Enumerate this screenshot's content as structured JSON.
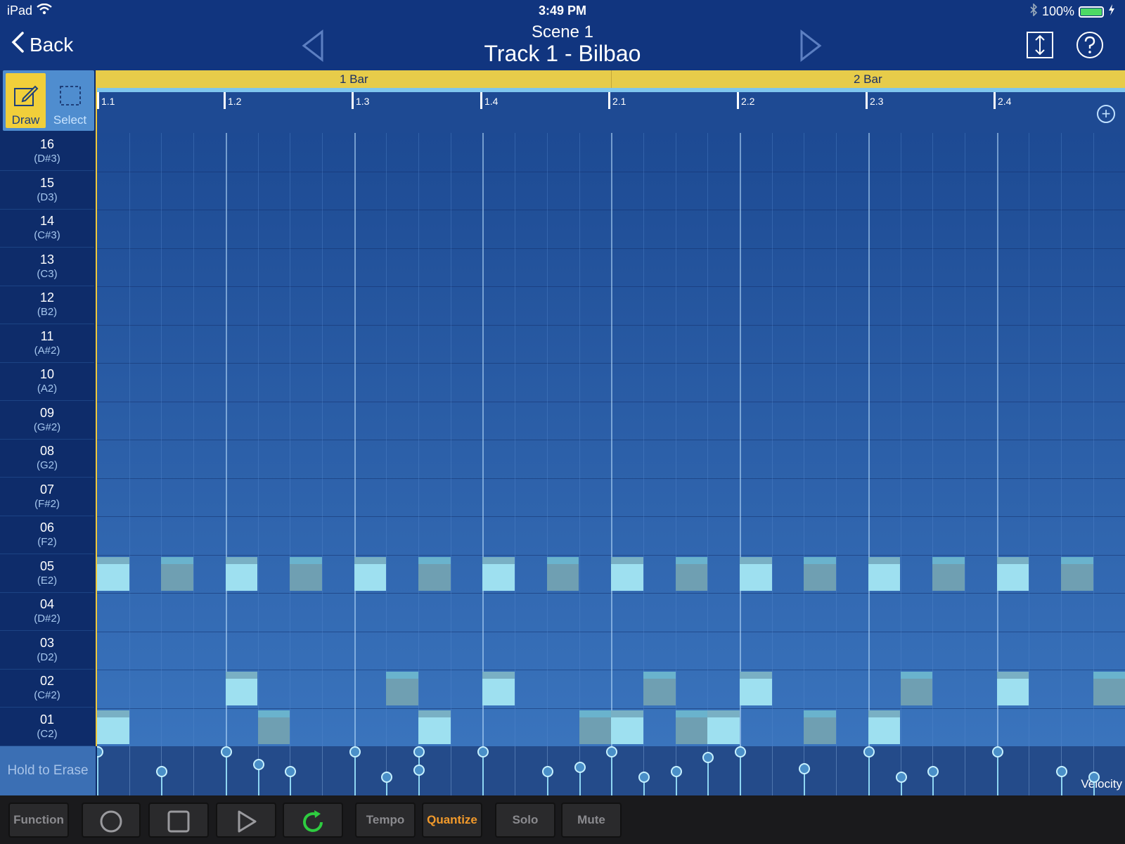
{
  "status": {
    "device": "iPad",
    "time": "3:49 PM",
    "battery": "100%"
  },
  "header": {
    "back_label": "Back",
    "scene": "Scene  1",
    "track": "Track 1 - Bilbao"
  },
  "tools": {
    "draw_label": "Draw",
    "select_label": "Select"
  },
  "ruler": {
    "bars": [
      "1 Bar",
      "2 Bar"
    ],
    "beats": [
      "1.1",
      "1.2",
      "1.3",
      "1.4",
      "2.1",
      "2.2",
      "2.3",
      "2.4"
    ]
  },
  "pads": [
    {
      "num": "16",
      "pitch": "(D#3)"
    },
    {
      "num": "15",
      "pitch": "(D3)"
    },
    {
      "num": "14",
      "pitch": "(C#3)"
    },
    {
      "num": "13",
      "pitch": "(C3)"
    },
    {
      "num": "12",
      "pitch": "(B2)"
    },
    {
      "num": "11",
      "pitch": "(A#2)"
    },
    {
      "num": "10",
      "pitch": "(A2)"
    },
    {
      "num": "09",
      "pitch": "(G#2)"
    },
    {
      "num": "08",
      "pitch": "(G2)"
    },
    {
      "num": "07",
      "pitch": "(F#2)"
    },
    {
      "num": "06",
      "pitch": "(F2)"
    },
    {
      "num": "05",
      "pitch": "(E2)"
    },
    {
      "num": "04",
      "pitch": "(D#2)"
    },
    {
      "num": "03",
      "pitch": "(D2)"
    },
    {
      "num": "02",
      "pitch": "(C#2)"
    },
    {
      "num": "01",
      "pitch": "(C2)"
    }
  ],
  "velocity": {
    "hold_label": "Hold to Erase",
    "lane_label": "Velocity"
  },
  "transport": {
    "function_label": "Function",
    "tempo_label": "Tempo",
    "quantize_label": "Quantize",
    "solo_label": "Solo",
    "mute_label": "Mute"
  },
  "colors": {
    "accent": "#f1cf3a",
    "loop": "#2ecc40",
    "quantize": "#f29a2b"
  }
}
